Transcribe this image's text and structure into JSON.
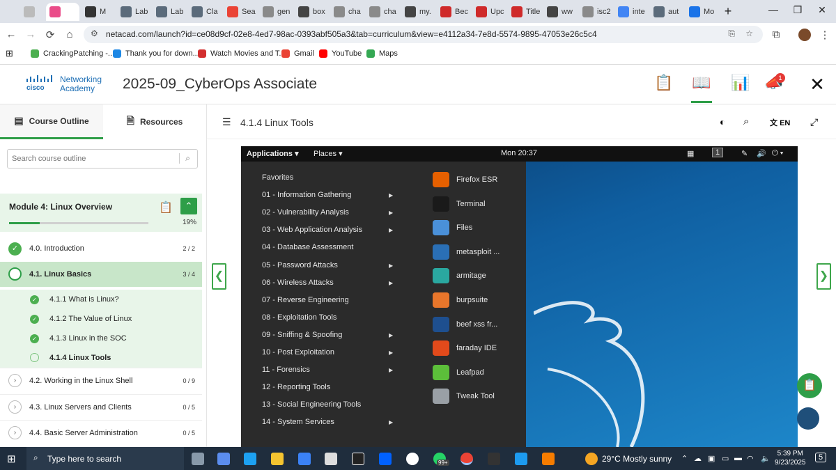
{
  "browser": {
    "tabs": [
      {
        "label": "",
        "color": "#ea4c89"
      },
      {
        "label": "M",
        "color": "#333333"
      },
      {
        "label": "Lab",
        "color": "#5b6b7b"
      },
      {
        "label": "Lab",
        "color": "#5b6b7b"
      },
      {
        "label": "Cla",
        "color": "#5b6b7b"
      },
      {
        "label": "Sea",
        "color": "#ea4335"
      },
      {
        "label": "gen",
        "color": "#8a8a8a"
      },
      {
        "label": "box",
        "color": "#444444"
      },
      {
        "label": "cha",
        "color": "#8a8a8a"
      },
      {
        "label": "cha",
        "color": "#8a8a8a"
      },
      {
        "label": "my.",
        "color": "#444444"
      },
      {
        "label": "Bec",
        "color": "#cf2a2a"
      },
      {
        "label": "Upc",
        "color": "#cf2a2a"
      },
      {
        "label": "Title",
        "color": "#cf2a2a"
      },
      {
        "label": "ww",
        "color": "#444444"
      },
      {
        "label": "isc2",
        "color": "#8a8a8a"
      },
      {
        "label": "inte",
        "color": "#4285f4"
      },
      {
        "label": "aut",
        "color": "#5b6b7b"
      },
      {
        "label": "Mo",
        "color": "#1a73e8"
      }
    ],
    "url": "netacad.com/launch?id=ce08d9cf-02e8-4ed7-98ac-0393abf505a3&tab=curriculum&view=e4112a34-7e8d-5574-9895-47053e26c5c4",
    "bookmarks": [
      {
        "label": "CrackingPatching -...",
        "color": "#4caf50"
      },
      {
        "label": "Thank you for down...",
        "color": "#1e88e5"
      },
      {
        "label": "Watch Movies and T...",
        "color": "#d32f2f"
      },
      {
        "label": "Gmail",
        "color": "#ea4335"
      },
      {
        "label": "YouTube",
        "color": "#ff0000"
      },
      {
        "label": "Maps",
        "color": "#34a853"
      }
    ]
  },
  "header": {
    "brand_line1": "Networking",
    "brand_line2": "Academy",
    "logo_text": "cisco",
    "course_title": "2025-09_CyberOps Associate",
    "notification_count": "1"
  },
  "sidebar": {
    "tab_outline": "Course Outline",
    "tab_resources": "Resources",
    "search_placeholder": "Search course outline",
    "module_title": "Module 4: Linux Overview",
    "module_progress": "19%",
    "module_progress_value": 0.19,
    "sections": [
      {
        "label": "4.0. Introduction",
        "count": "2 / 2",
        "state": "done"
      },
      {
        "label": "4.1. Linux Basics",
        "count": "3 / 4",
        "state": "active"
      },
      {
        "label": "4.1.1 What is Linux?",
        "state": "done-sub"
      },
      {
        "label": "4.1.2 The Value of Linux",
        "state": "done-sub"
      },
      {
        "label": "4.1.3 Linux in the SOC",
        "state": "done-sub"
      },
      {
        "label": "4.1.4 Linux Tools",
        "state": "current-sub"
      },
      {
        "label": "4.2. Working in the Linux Shell",
        "count": "0 / 9",
        "state": "todo"
      },
      {
        "label": "4.3. Linux Servers and Clients",
        "count": "0 / 5",
        "state": "todo"
      },
      {
        "label": "4.4. Basic Server Administration",
        "count": "0 / 5",
        "state": "todo"
      }
    ]
  },
  "content": {
    "lesson_title": "4.1.4 Linux Tools",
    "language": "EN",
    "kali": {
      "applications": "Applications",
      "places": "Places",
      "clock": "Mon 20:37",
      "workspace": "1",
      "categories": [
        {
          "label": "Favorites",
          "arrow": false
        },
        {
          "label": "01 - Information Gathering",
          "arrow": true
        },
        {
          "label": "02 - Vulnerability Analysis",
          "arrow": true
        },
        {
          "label": "03 - Web Application Analysis",
          "arrow": true
        },
        {
          "label": "04 - Database Assessment",
          "arrow": false
        },
        {
          "label": "05 - Password Attacks",
          "arrow": true
        },
        {
          "label": "06 - Wireless Attacks",
          "arrow": true
        },
        {
          "label": "07 - Reverse Engineering",
          "arrow": false
        },
        {
          "label": "08 - Exploitation Tools",
          "arrow": false
        },
        {
          "label": "09 - Sniffing & Spoofing",
          "arrow": true
        },
        {
          "label": "10 - Post Exploitation",
          "arrow": true
        },
        {
          "label": "11 - Forensics",
          "arrow": true
        },
        {
          "label": "12 - Reporting Tools",
          "arrow": false
        },
        {
          "label": "13 - Social Engineering Tools",
          "arrow": false
        },
        {
          "label": "14 - System Services",
          "arrow": true
        }
      ],
      "apps": [
        {
          "label": "Firefox ESR",
          "color": "#e66000"
        },
        {
          "label": "Terminal",
          "color": "#1a1a1a"
        },
        {
          "label": "Files",
          "color": "#4a90d9"
        },
        {
          "label": "metasploit ...",
          "color": "#2a6fb5"
        },
        {
          "label": "armitage",
          "color": "#2aa8a0"
        },
        {
          "label": "burpsuite",
          "color": "#e8762b"
        },
        {
          "label": "beef xss fr...",
          "color": "#1e4f8f"
        },
        {
          "label": "faraday IDE",
          "color": "#e24a1b"
        },
        {
          "label": "Leafpad",
          "color": "#5cbf3a"
        },
        {
          "label": "Tweak Tool",
          "color": "#9aa0a6"
        }
      ]
    }
  },
  "taskbar": {
    "search_placeholder": "Type here to search",
    "whatsapp_badge": "99+",
    "weather": "29°C  Mostly sunny",
    "time": "5:39 PM",
    "date": "9/23/2025",
    "notif_count": "5"
  }
}
